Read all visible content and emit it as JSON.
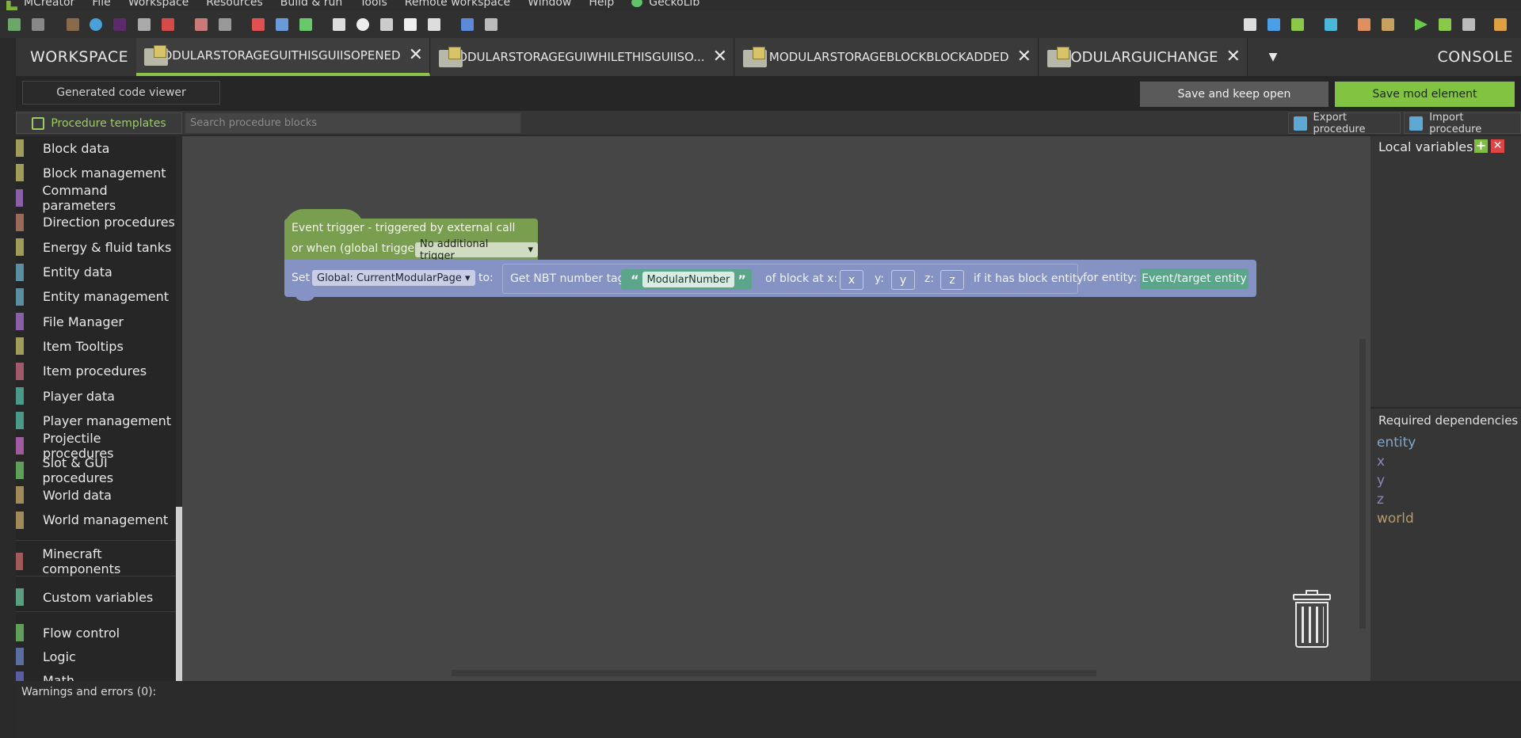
{
  "menu": {
    "items": [
      "MCreator",
      "File",
      "Workspace",
      "Resources",
      "Build & run",
      "Tools",
      "Remote workspace",
      "Window",
      "Help"
    ],
    "gecko_label": "GeckoLib"
  },
  "tabs": {
    "workspace": "WORKSPACE",
    "items": [
      {
        "label": "MODULARSTORAGEGUITHISGUIISOPENED",
        "active": true
      },
      {
        "label": "MODULARSTORAGEGUIWHILETHISGUIISO...",
        "active": false
      },
      {
        "label": "MODULARSTORAGEBLOCKBLOCKADDED",
        "active": false
      },
      {
        "label": "MODULARGUICHANGE",
        "active": false
      }
    ],
    "close_glyph": "✕",
    "dropdown_glyph": "▼",
    "console": "CONSOLE"
  },
  "actions": {
    "code_viewer": "Generated code viewer",
    "save_keep_open": "Save and keep open",
    "save_mod_element": "Save mod element"
  },
  "templates": {
    "label": "Procedure templates",
    "search_placeholder": "Search procedure blocks",
    "export": "Export procedure",
    "import": "Import procedure"
  },
  "categories": [
    {
      "label": "Block data",
      "color": "#a09d5c"
    },
    {
      "label": "Block management",
      "color": "#a09d5c"
    },
    {
      "label": "Command parameters",
      "color": "#8b5ea8"
    },
    {
      "label": "Direction procedures",
      "color": "#9a6a58"
    },
    {
      "label": "Energy & fluid tanks",
      "color": "#a09d5c"
    },
    {
      "label": "Entity data",
      "color": "#5a8ea0"
    },
    {
      "label": "Entity management",
      "color": "#5a8ea0"
    },
    {
      "label": "File Manager",
      "color": "#8b5ea8"
    },
    {
      "label": "Item Tooltips",
      "color": "#a09d5c"
    },
    {
      "label": "Item procedures",
      "color": "#a05a6a"
    },
    {
      "label": "Player data",
      "color": "#4a9a8a"
    },
    {
      "label": "Player management",
      "color": "#4a9a8a"
    },
    {
      "label": "Projectile procedures",
      "color": "#a05aa0"
    },
    {
      "label": "Slot & GUI procedures",
      "color": "#5ea05a"
    },
    {
      "label": "World data",
      "color": "#a08a5a"
    },
    {
      "label": "World management",
      "color": "#a08a5a"
    }
  ],
  "categories_extra": [
    {
      "label": "Minecraft components",
      "color": "#a05a5a"
    },
    {
      "label": "Custom variables",
      "color": "#5aa080"
    },
    {
      "label": "Flow control",
      "color": "#5ea05a"
    },
    {
      "label": "Logic",
      "color": "#5a6ea0"
    },
    {
      "label": "Math",
      "color": "#5a5ea0"
    }
  ],
  "blocks": {
    "event_line1": "Event trigger - triggered by external call",
    "event_line2": "or when (global trigger):",
    "event_trigger_value": "No additional trigger",
    "set_label": "Set",
    "set_variable": "Global: CurrentModularPage",
    "to_label": "to:",
    "nbt_label": "Get NBT number tag",
    "nbt_tag": "ModularNumber",
    "of_block_label": "of block at x:",
    "x": "x",
    "y_label": "y:",
    "y": "y",
    "z_label": "z:",
    "z": "z",
    "if_has_label": "if it has block entity",
    "for_entity_label": "for entity:",
    "entity_value": "Event/target entity"
  },
  "right_panel": {
    "local_variables": "Local variables",
    "add_glyph": "+",
    "remove_glyph": "✕",
    "required_dependencies": "Required dependencies",
    "dependencies": [
      {
        "name": "entity",
        "color": "#7fa7c8"
      },
      {
        "name": "x",
        "color": "#8a8ab8"
      },
      {
        "name": "y",
        "color": "#8a8ab8"
      },
      {
        "name": "z",
        "color": "#8a8ab8"
      },
      {
        "name": "world",
        "color": "#b89a6a"
      }
    ]
  },
  "bottom": {
    "warnings": "Warnings and errors (0):"
  }
}
